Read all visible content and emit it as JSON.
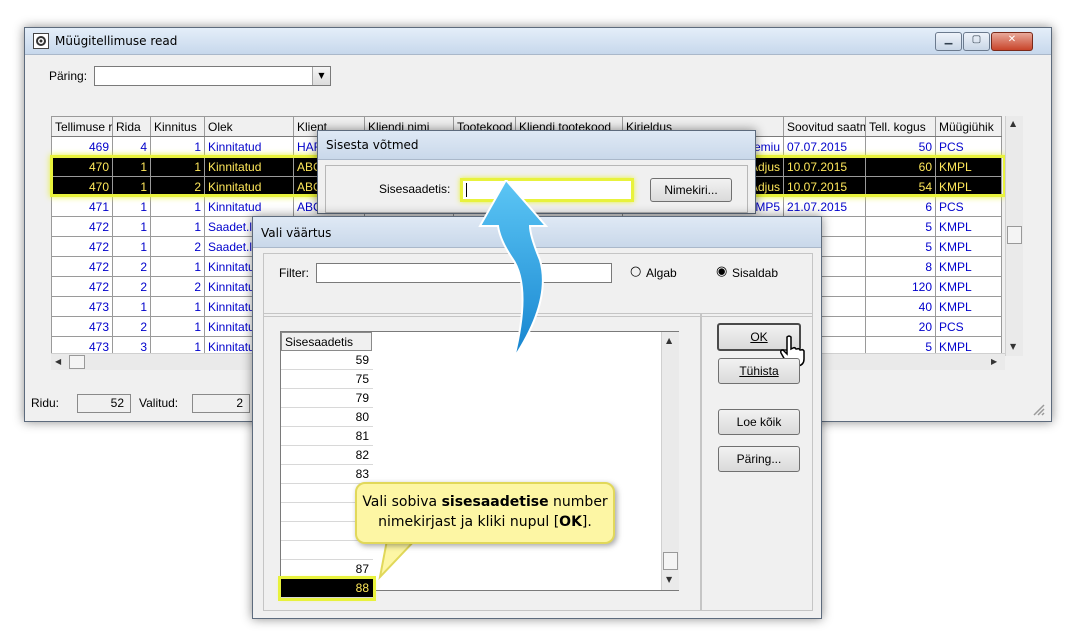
{
  "main_window": {
    "title": "Müügitellimuse read",
    "query_label": "Päring:",
    "query_value": "",
    "columns": [
      "Tellimuse r",
      "Rida",
      "Kinnitus",
      "Olek",
      "Klient",
      "Kliendi nimi",
      "Tootekood",
      "Kliendi tootekood",
      "Kirjeldus",
      "Soovitud saatm",
      "Tell. kogus",
      "Müügiühik"
    ],
    "rows": [
      {
        "order": "469",
        "line": "4",
        "conf": "1",
        "status": "Kinnitatud",
        "client": "HAF",
        "desc": "remiu",
        "date": "07.07.2015",
        "qty": "50",
        "unit": "PCS",
        "selected": false
      },
      {
        "order": "470",
        "line": "1",
        "conf": "1",
        "status": "Kinnitatud",
        "client": "ABC",
        "desc": "Adjus",
        "date": "10.07.2015",
        "qty": "60",
        "unit": "KMPL",
        "selected": true
      },
      {
        "order": "470",
        "line": "1",
        "conf": "2",
        "status": "Kinnitatud",
        "client": "ABC",
        "desc": "Adjus",
        "date": "10.07.2015",
        "qty": "54",
        "unit": "KMPL",
        "selected": true
      },
      {
        "order": "471",
        "line": "1",
        "conf": "1",
        "status": "Kinnitatud",
        "client": "ABC",
        "desc": "IMP5",
        "date": "21.07.2015",
        "qty": "6",
        "unit": "PCS",
        "selected": false
      },
      {
        "order": "472",
        "line": "1",
        "conf": "1",
        "status": "Saadet.lo",
        "client": "",
        "desc": "",
        "date": "2015",
        "qty": "5",
        "unit": "KMPL",
        "selected": false
      },
      {
        "order": "472",
        "line": "1",
        "conf": "2",
        "status": "Saadet.lo",
        "client": "",
        "desc": "",
        "date": "2015",
        "qty": "5",
        "unit": "KMPL",
        "selected": false
      },
      {
        "order": "472",
        "line": "2",
        "conf": "1",
        "status": "Kinnitatu",
        "client": "",
        "desc": "",
        "date": "2015",
        "qty": "8",
        "unit": "KMPL",
        "selected": false
      },
      {
        "order": "472",
        "line": "2",
        "conf": "2",
        "status": "Kinnitatu",
        "client": "",
        "desc": "",
        "date": "2015",
        "qty": "120",
        "unit": "KMPL",
        "selected": false
      },
      {
        "order": "473",
        "line": "1",
        "conf": "1",
        "status": "Kinnitatu",
        "client": "",
        "desc": "",
        "date": "2015",
        "qty": "40",
        "unit": "KMPL",
        "selected": false
      },
      {
        "order": "473",
        "line": "2",
        "conf": "1",
        "status": "Kinnitatu",
        "client": "",
        "desc": "",
        "date": "2017",
        "qty": "20",
        "unit": "PCS",
        "selected": false
      },
      {
        "order": "473",
        "line": "3",
        "conf": "1",
        "status": "Kinnitatu",
        "client": "",
        "desc": "",
        "date": "2017",
        "qty": "5",
        "unit": "KMPL",
        "selected": false
      }
    ],
    "status_rows_label": "Ridu:",
    "status_rows_value": "52",
    "status_selected_label": "Valitud:",
    "status_selected_value": "2"
  },
  "keys_dialog": {
    "title": "Sisesta võtmed",
    "field_label": "Sisesaadetis:",
    "field_value": "",
    "list_button": "Nimekiri..."
  },
  "value_dialog": {
    "title": "Vali väärtus",
    "filter_label": "Filter:",
    "filter_value": "",
    "radio_starts": "Algab",
    "radio_contains": "Sisaldab",
    "list_header": "Sisesaadetis",
    "items": [
      "59",
      "75",
      "79",
      "80",
      "81",
      "82",
      "83",
      "",
      "",
      "",
      "",
      "87",
      "88"
    ],
    "selected_item": "88",
    "ok_button": "OK",
    "cancel_button": "Tühista",
    "load_all_button": "Loe kõik",
    "query_button": "Päring..."
  },
  "callout": {
    "line1_prefix": "Vali sobiva ",
    "line1_bold": "sisesaadetise",
    "line1_suffix": " number",
    "line2_prefix": "nimekirjast ja kliki nupul [",
    "line2_bold": "OK",
    "line2_suffix": "]."
  },
  "colors": {
    "highlight": "#e8f23c",
    "selected_text": "#ffe85a",
    "link_text": "#0000cc",
    "arrow": "#2aa3e6"
  }
}
